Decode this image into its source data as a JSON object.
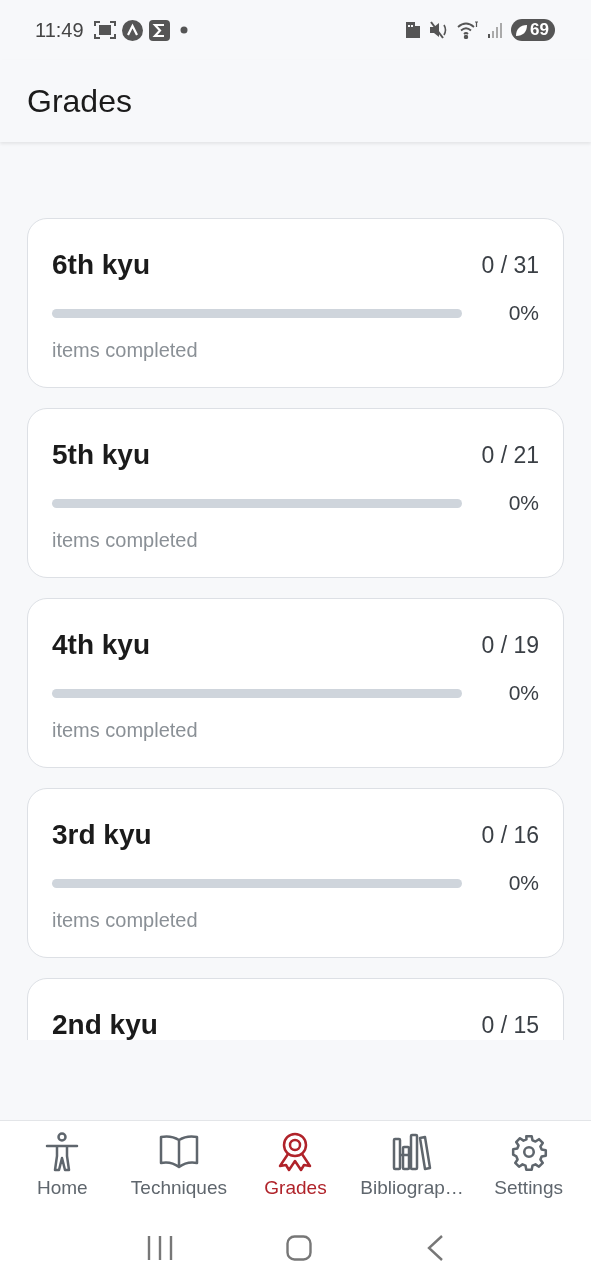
{
  "status_bar": {
    "time": "11:49",
    "battery": "69"
  },
  "header": {
    "title": "Grades"
  },
  "grades": [
    {
      "title": "6th kyu",
      "count": "0 / 31",
      "level": 0,
      "percent": "0%",
      "caption": "items completed"
    },
    {
      "title": "5th kyu",
      "count": "0 / 21",
      "level": 0,
      "percent": "0%",
      "caption": "items completed"
    },
    {
      "title": "4th kyu",
      "count": "0 / 19",
      "level": 0,
      "percent": "0%",
      "caption": "items completed"
    },
    {
      "title": "3rd kyu",
      "count": "0 / 16",
      "level": 0,
      "percent": "0%",
      "caption": "items completed"
    },
    {
      "title": "2nd kyu",
      "count": "0 / 15"
    }
  ],
  "tab_bar": [
    {
      "label": "Home",
      "selected": false
    },
    {
      "label": "Techniques",
      "selected": false
    },
    {
      "label": "Grades",
      "selected": true
    },
    {
      "label": "Bibliograp…",
      "selected": false
    },
    {
      "label": "Settings",
      "selected": false
    }
  ]
}
